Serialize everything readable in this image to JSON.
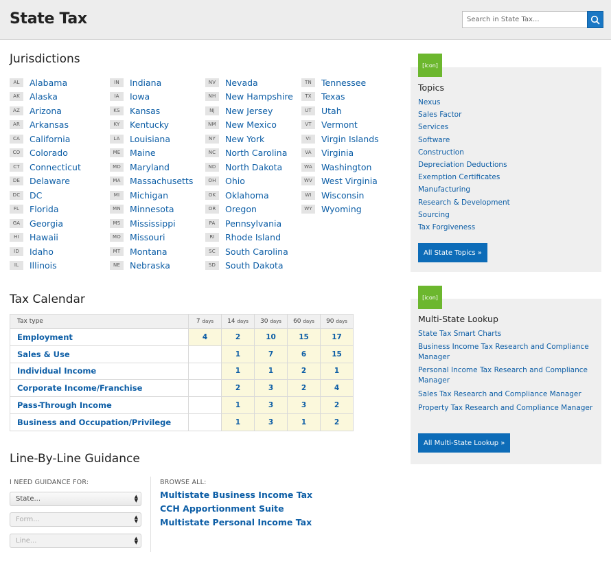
{
  "header": {
    "title": "State Tax",
    "search_placeholder": "Search in State Tax..."
  },
  "jurisdictions": {
    "heading": "Jurisdictions",
    "columns": [
      [
        {
          "abbr": "AL",
          "name": "Alabama"
        },
        {
          "abbr": "AK",
          "name": "Alaska"
        },
        {
          "abbr": "AZ",
          "name": "Arizona"
        },
        {
          "abbr": "AR",
          "name": "Arkansas"
        },
        {
          "abbr": "CA",
          "name": "California"
        },
        {
          "abbr": "CO",
          "name": "Colorado"
        },
        {
          "abbr": "CT",
          "name": "Connecticut"
        },
        {
          "abbr": "DE",
          "name": "Delaware"
        },
        {
          "abbr": "DC",
          "name": "DC"
        },
        {
          "abbr": "FL",
          "name": "Florida"
        },
        {
          "abbr": "GA",
          "name": "Georgia"
        },
        {
          "abbr": "HI",
          "name": "Hawaii"
        },
        {
          "abbr": "ID",
          "name": "Idaho"
        },
        {
          "abbr": "IL",
          "name": "Illinois"
        }
      ],
      [
        {
          "abbr": "IN",
          "name": "Indiana"
        },
        {
          "abbr": "IA",
          "name": "Iowa"
        },
        {
          "abbr": "KS",
          "name": "Kansas"
        },
        {
          "abbr": "KY",
          "name": "Kentucky"
        },
        {
          "abbr": "LA",
          "name": "Louisiana"
        },
        {
          "abbr": "ME",
          "name": "Maine"
        },
        {
          "abbr": "MD",
          "name": "Maryland"
        },
        {
          "abbr": "MA",
          "name": "Massachusetts"
        },
        {
          "abbr": "MI",
          "name": "Michigan"
        },
        {
          "abbr": "MN",
          "name": "Minnesota"
        },
        {
          "abbr": "MS",
          "name": "Mississippi"
        },
        {
          "abbr": "MO",
          "name": "Missouri"
        },
        {
          "abbr": "MT",
          "name": "Montana"
        },
        {
          "abbr": "NE",
          "name": "Nebraska"
        }
      ],
      [
        {
          "abbr": "NV",
          "name": "Nevada"
        },
        {
          "abbr": "NH",
          "name": "New Hampshire"
        },
        {
          "abbr": "NJ",
          "name": "New Jersey"
        },
        {
          "abbr": "NM",
          "name": "New Mexico"
        },
        {
          "abbr": "NY",
          "name": "New York"
        },
        {
          "abbr": "NC",
          "name": "North Carolina"
        },
        {
          "abbr": "ND",
          "name": "North Dakota"
        },
        {
          "abbr": "OH",
          "name": "Ohio"
        },
        {
          "abbr": "OK",
          "name": "Oklahoma"
        },
        {
          "abbr": "OR",
          "name": "Oregon"
        },
        {
          "abbr": "PA",
          "name": "Pennsylvania"
        },
        {
          "abbr": "RI",
          "name": "Rhode Island"
        },
        {
          "abbr": "SC",
          "name": "South Carolina"
        },
        {
          "abbr": "SD",
          "name": "South Dakota"
        }
      ],
      [
        {
          "abbr": "TN",
          "name": "Tennessee"
        },
        {
          "abbr": "TX",
          "name": "Texas"
        },
        {
          "abbr": "UT",
          "name": "Utah"
        },
        {
          "abbr": "VT",
          "name": "Vermont"
        },
        {
          "abbr": "VI",
          "name": "Virgin Islands"
        },
        {
          "abbr": "VA",
          "name": "Virginia"
        },
        {
          "abbr": "WA",
          "name": "Washington"
        },
        {
          "abbr": "WV",
          "name": "West Virginia"
        },
        {
          "abbr": "WI",
          "name": "Wisconsin"
        },
        {
          "abbr": "WY",
          "name": "Wyoming"
        }
      ]
    ]
  },
  "tax_calendar": {
    "heading": "Tax Calendar",
    "header_label": "Tax type",
    "columns": [
      {
        "num": "7",
        "unit": "days"
      },
      {
        "num": "14",
        "unit": "days"
      },
      {
        "num": "30",
        "unit": "days"
      },
      {
        "num": "60",
        "unit": "days"
      },
      {
        "num": "90",
        "unit": "days"
      }
    ],
    "rows": [
      {
        "name": "Employment",
        "values": [
          "4",
          "2",
          "10",
          "15",
          "17"
        ]
      },
      {
        "name": "Sales & Use",
        "values": [
          "",
          "1",
          "7",
          "6",
          "15"
        ]
      },
      {
        "name": "Individual Income",
        "values": [
          "",
          "1",
          "1",
          "2",
          "1"
        ]
      },
      {
        "name": "Corporate Income/Franchise",
        "values": [
          "",
          "2",
          "3",
          "2",
          "4"
        ]
      },
      {
        "name": "Pass-Through Income",
        "values": [
          "",
          "1",
          "3",
          "3",
          "2"
        ]
      },
      {
        "name": "Business and Occupation/Privilege",
        "values": [
          "",
          "1",
          "3",
          "1",
          "2"
        ]
      }
    ]
  },
  "guidance": {
    "heading": "Line-By-Line Guidance",
    "need_label": "I NEED GUIDANCE FOR:",
    "browse_label": "BROWSE ALL:",
    "selects": [
      "State...",
      "Form...",
      "Line..."
    ],
    "browse_links": [
      "Multistate Business Income Tax",
      "CCH Apportionment Suite",
      "Multistate Personal Income Tax"
    ]
  },
  "topics": {
    "icon_text": "[icon]",
    "heading": "Topics",
    "items": [
      "Nexus",
      "Sales Factor",
      "Services",
      "Software",
      "Construction",
      "Depreciation Deductions",
      "Exemption Certificates",
      "Manufacturing",
      "Research & Development",
      "Sourcing",
      "Tax Forgiveness"
    ],
    "button": "All State Topics »"
  },
  "multistate": {
    "icon_text": "[icon]",
    "heading": "Multi-State Lookup",
    "items": [
      "State Tax Smart Charts",
      "Business Income Tax Research and Compliance Manager",
      "Personal Income Tax Research and Compliance Manager",
      "Sales Tax Research and Compliance Manager",
      "Property Tax Research and Compliance Manager"
    ],
    "button": "All Multi-State Lookup »"
  }
}
